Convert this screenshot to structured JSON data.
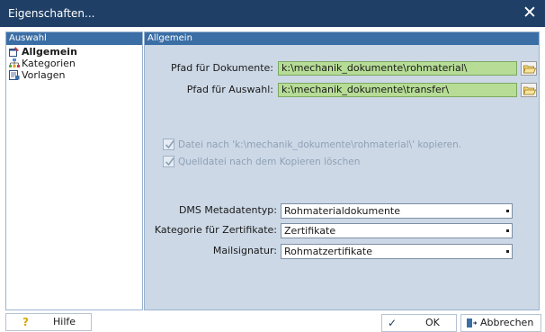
{
  "window": {
    "title": "Eigenschaften...",
    "close_glyph": "✕"
  },
  "sidebar": {
    "header": "Auswahl",
    "items": [
      {
        "label": "Allgemein",
        "icon": "properties-icon",
        "selected": true
      },
      {
        "label": "Kategorien",
        "icon": "categories-icon",
        "selected": false
      },
      {
        "label": "Vorlagen",
        "icon": "templates-icon",
        "selected": false
      }
    ]
  },
  "main": {
    "header": "Allgemein",
    "doc_path": {
      "label": "Pfad für Dokumente:",
      "value": "k:\\mechanik_dokumente\\rohmaterial\\"
    },
    "selection_path": {
      "label": "Pfad für Auswahl:",
      "value": "k:\\mechanik_dokumente\\transfer\\"
    },
    "copy_checkbox": {
      "label": "Datei nach 'k:\\mechanik_dokumente\\rohmaterial\\' kopieren.",
      "checked": true,
      "disabled": true
    },
    "delete_checkbox": {
      "label": "Quelldatei nach dem Kopieren löschen",
      "checked": true,
      "disabled": true
    },
    "dms_type": {
      "label": "DMS Metadatentyp:",
      "value": "Rohmaterialdokumente"
    },
    "cert_category": {
      "label": "Kategorie für Zertifikate:",
      "value": "Zertifikate"
    },
    "mail_signature": {
      "label": "Mailsignatur:",
      "value": "Rohmatzertifikate"
    }
  },
  "footer": {
    "help": {
      "glyph": "?",
      "label": "Hilfe"
    },
    "ok": {
      "glyph": "✓",
      "label": "OK"
    },
    "cancel": {
      "label": "Abbrechen"
    }
  },
  "colors": {
    "titlebar": "#1f3f66",
    "panel_header": "#3b6ea5",
    "panel_bg": "#ccd8e6",
    "path_field": "#b6dc96"
  }
}
